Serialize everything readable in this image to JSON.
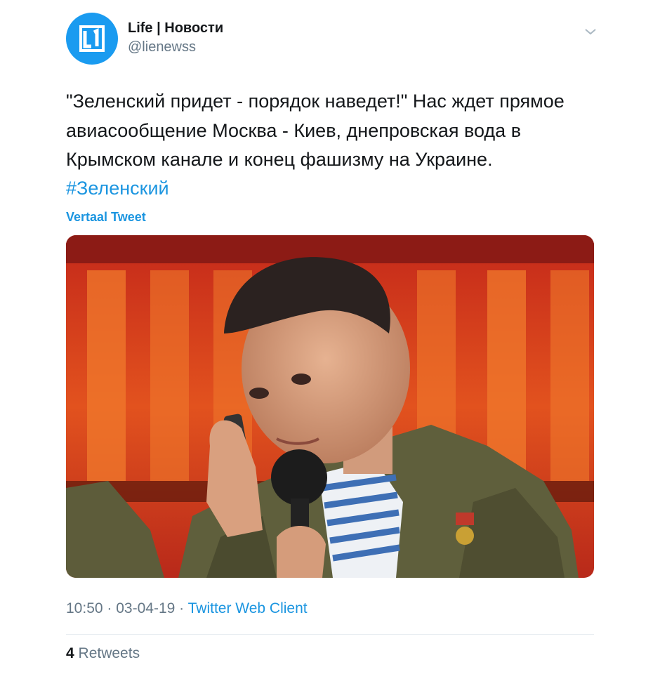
{
  "account": {
    "name": "Life | Новости",
    "handle": "@lienewss",
    "avatar_icon": "life-logo-icon",
    "avatar_color": "#1a9bf0"
  },
  "menu_icon": "chevron-down-icon",
  "tweet": {
    "text": "\"Зеленский придет - порядок наведет!\" Нас ждет прямое авиасообщение Москва - Киев, днепровская вода в Крымском канале и конец фашизму на Украине.",
    "hashtag": "#Зеленский",
    "translate_label": "Vertaal Tweet"
  },
  "meta": {
    "time": "10:50",
    "sep1": "·",
    "date": "03-04-19",
    "sep2": "·",
    "source": "Twitter Web Client"
  },
  "stats": {
    "retweets_count": "4",
    "retweets_label": "Retweets"
  },
  "colors": {
    "link": "#1b95e0",
    "secondary": "#657786",
    "text": "#14171a"
  }
}
